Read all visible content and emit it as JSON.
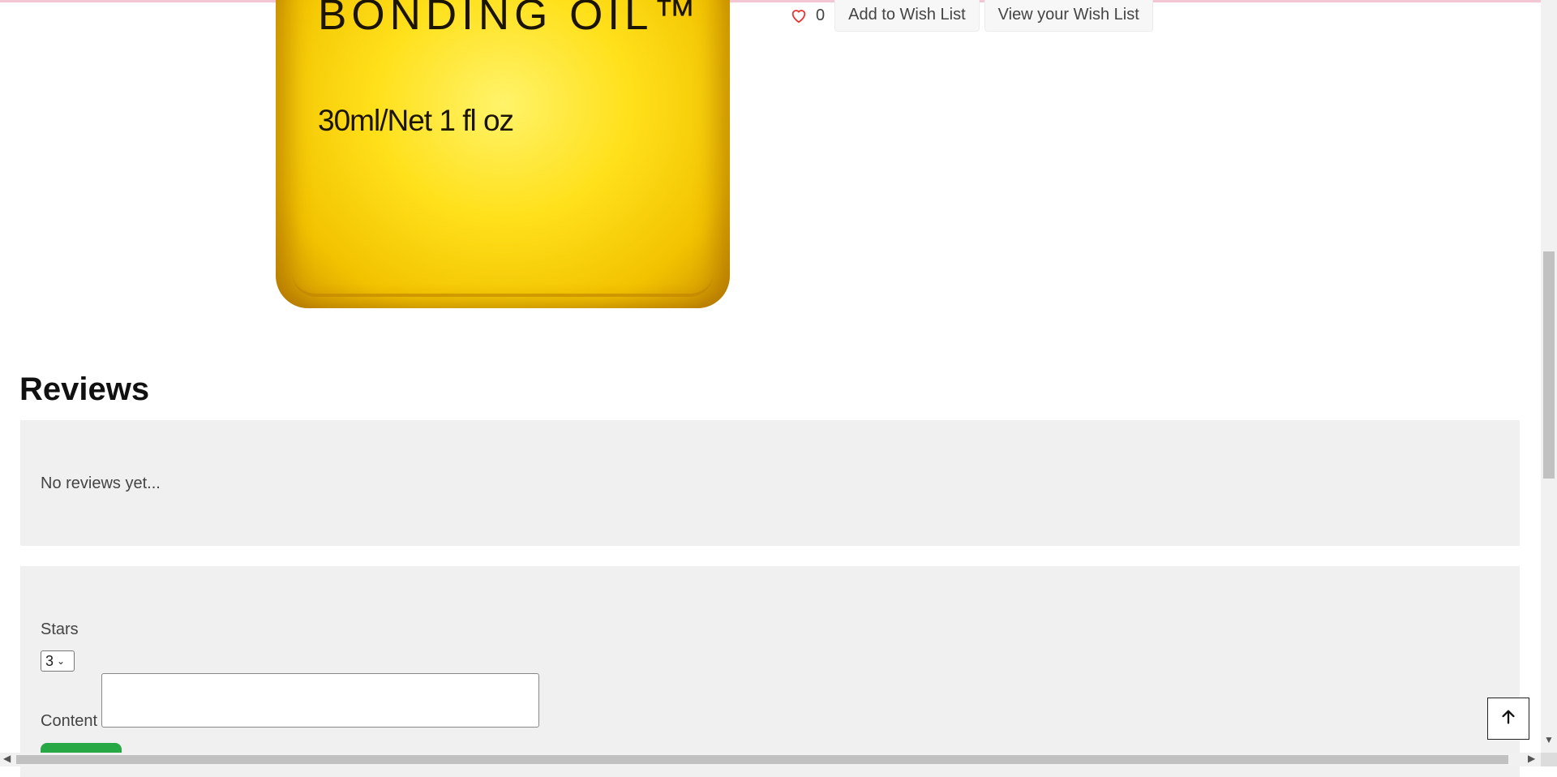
{
  "product": {
    "image_text_main": "BONDING OIL™",
    "image_text_sub": "30ml/Net 1 fl oz"
  },
  "wishlist": {
    "count": "0",
    "add_label": "Add to Wish List",
    "view_label": "View your Wish List",
    "heart_color": "#e53935"
  },
  "reviews": {
    "title": "Reviews",
    "empty_text": "No reviews yet..."
  },
  "review_form": {
    "stars_label": "Stars",
    "stars_value": "3",
    "content_label": "Content",
    "content_value": "",
    "submit_color": "#28a745"
  },
  "icons": {
    "back_to_top": "arrow-up-icon",
    "wishlist": "heart-icon"
  }
}
